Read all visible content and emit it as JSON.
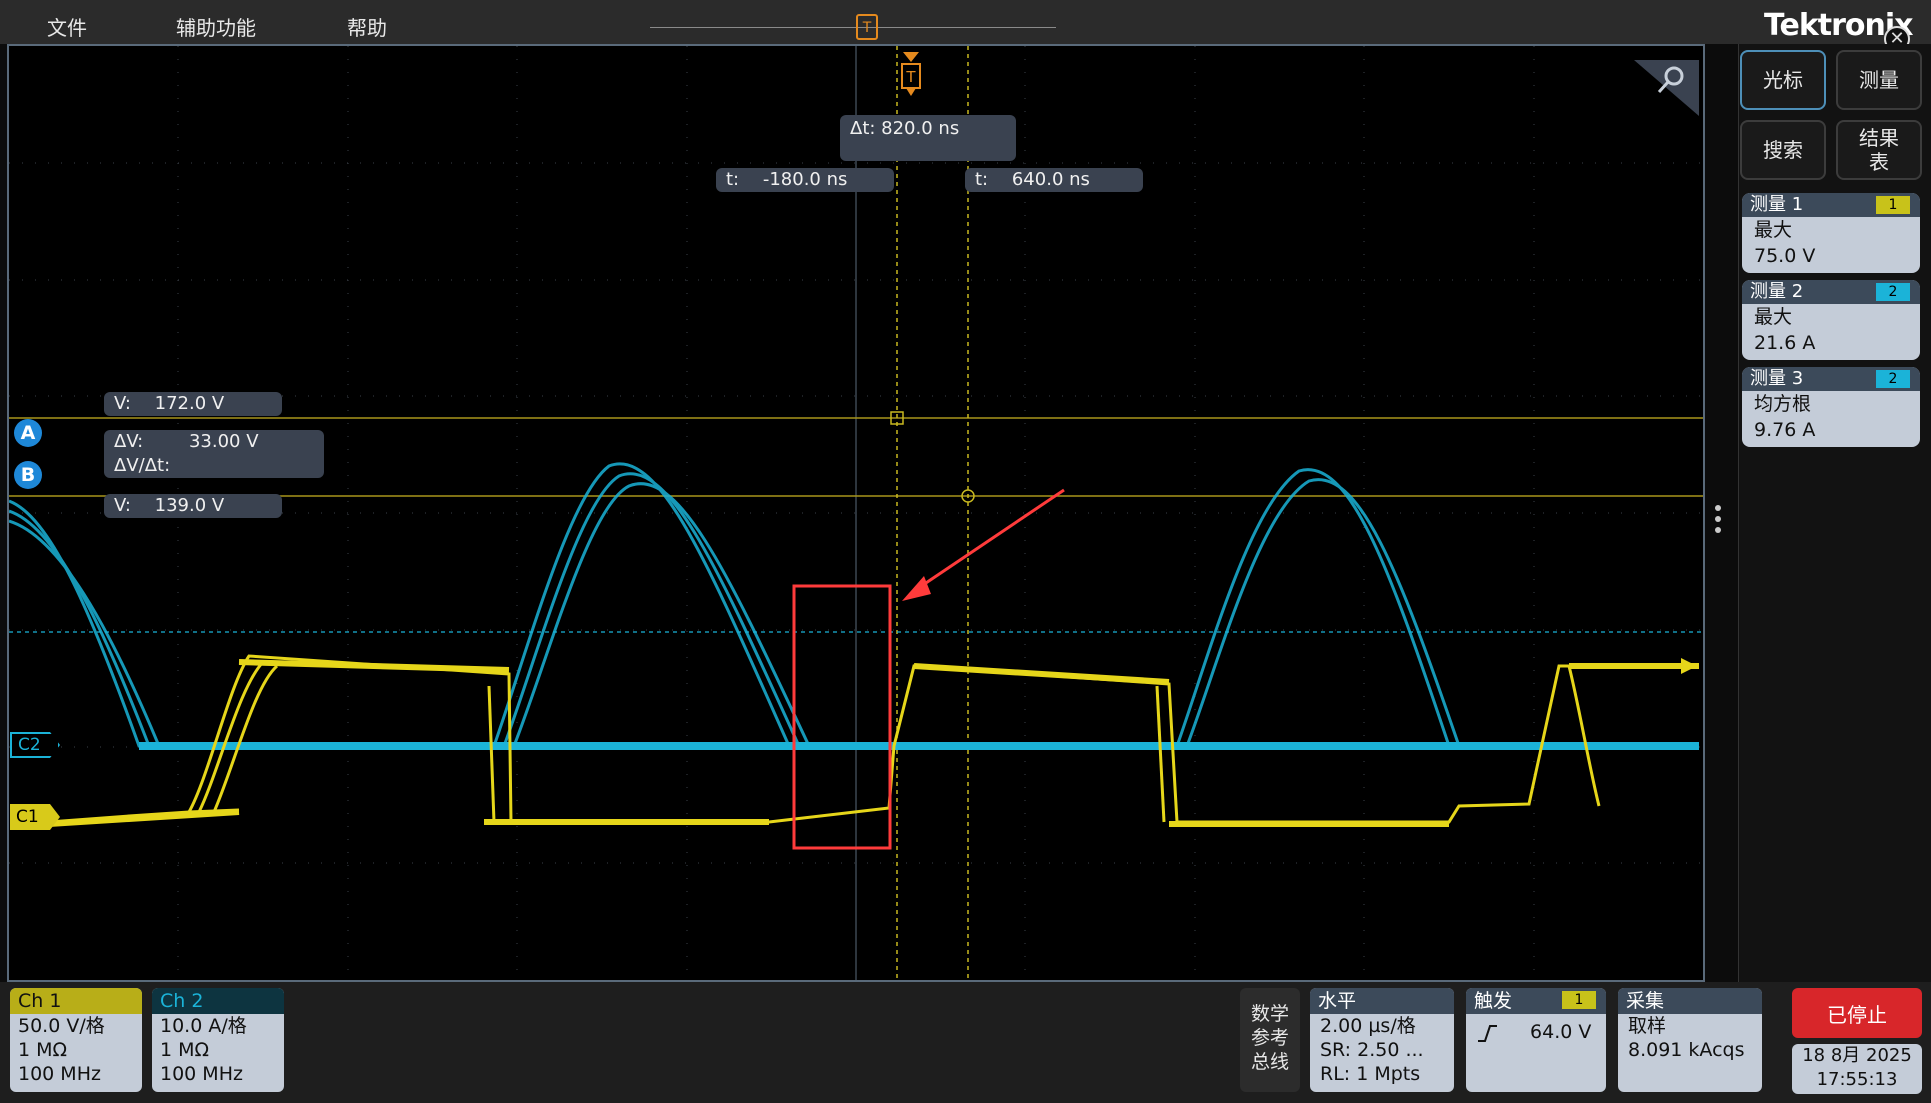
{
  "menu": {
    "file": "文件",
    "utility": "辅助功能",
    "help": "帮助"
  },
  "logo": "Tektronix",
  "trigger_marker": "T",
  "close_glyph": "✕",
  "cursor_readouts": {
    "delta_t": "Δt:  820.0 ns",
    "t1_label": "t:",
    "t1_value": "-180.0 ns",
    "t2_label": "t:",
    "t2_value": "640.0 ns",
    "v1_label": "V:",
    "v1_value": "172.0 V",
    "delta_v_label": "ΔV:",
    "delta_v_value": "33.00 V",
    "dv_dt_label": "ΔV/Δt:",
    "v2_label": "V:",
    "v2_value": "139.0 V"
  },
  "cursor_badges": {
    "a": "A",
    "b": "B"
  },
  "channel_markers": {
    "c1": "C1",
    "c2": "C2"
  },
  "side_buttons": {
    "cursor": "光标",
    "measure": "测量",
    "search": "搜索",
    "results": "结果\n表"
  },
  "measurements": [
    {
      "title": "测量 1",
      "source": "1",
      "type": "最大",
      "value": "75.0 V",
      "color": "#c8c21a"
    },
    {
      "title": "测量 2",
      "source": "2",
      "type": "最大",
      "value": "21.6 A",
      "color": "#1bb3d8"
    },
    {
      "title": "测量 3",
      "source": "2",
      "type": "均方根",
      "value": "9.76 A",
      "color": "#1bb3d8"
    }
  ],
  "channels": [
    {
      "name": "Ch 1",
      "scale": "50.0 V/格",
      "impedance": "1 MΩ",
      "bandwidth": "100 MHz",
      "color": "#c8c21a"
    },
    {
      "name": "Ch 2",
      "scale": "10.0 A/格",
      "impedance": "1 MΩ",
      "bandwidth": "100 MHz",
      "color": "#1bb3d8"
    }
  ],
  "math_ref_bus": {
    "line1": "数学",
    "line2": "参考",
    "line3": "总线"
  },
  "horizontal": {
    "title": "水平",
    "scale": "2.00 µs/格",
    "sample_rate": "SR: 2.50 ...",
    "record_length": "RL: 1 Mpts"
  },
  "trigger": {
    "title": "触发",
    "source": "1",
    "level": "64.0 V",
    "slope_icon": "rising-edge-icon"
  },
  "acquisition": {
    "title": "采集",
    "mode": "取样",
    "count": "8.091 kAcqs"
  },
  "run_state": "已停止",
  "datetime": {
    "date": "18 8月 2025",
    "time": "17:55:13"
  },
  "colors": {
    "ch1": "#e6d61a",
    "ch2": "#1bb3d8",
    "cursor": "#c8a800",
    "trigger": "#e58a1e",
    "annotation": "#ff3b3b"
  }
}
